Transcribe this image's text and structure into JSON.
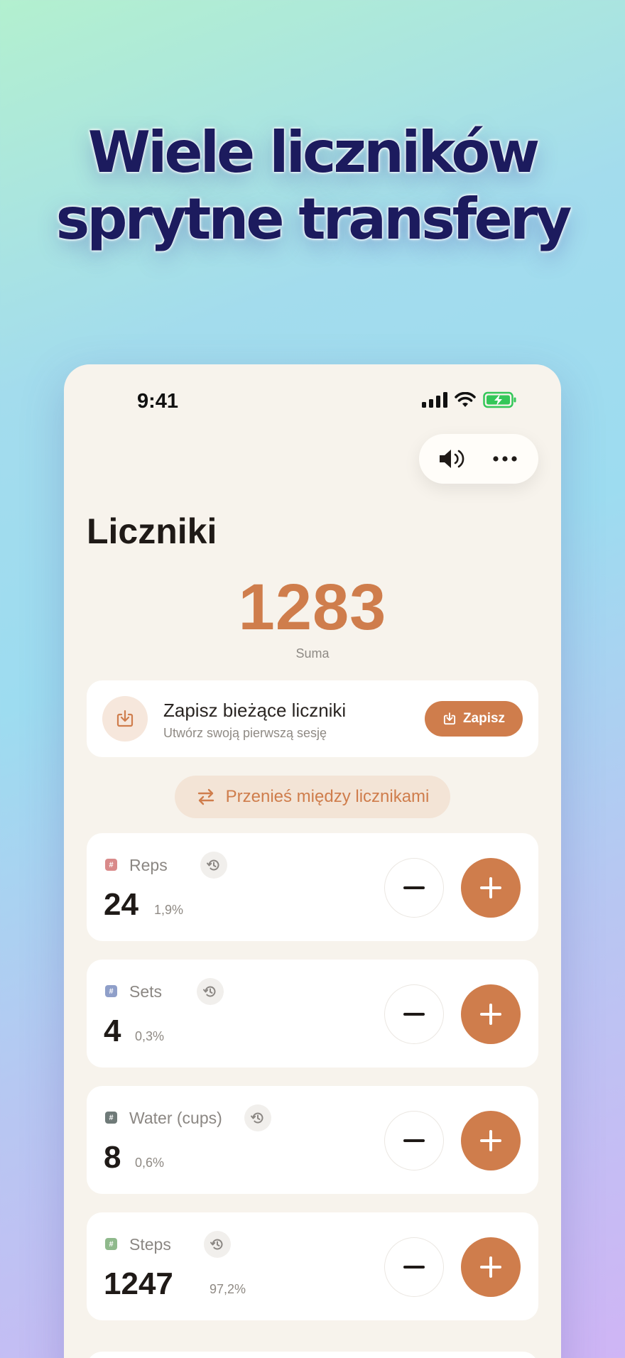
{
  "headline": {
    "line1": "Wiele liczników",
    "line2": "sprytne transfery"
  },
  "status": {
    "time": "9:41"
  },
  "page": {
    "title": "Liczniki"
  },
  "total": {
    "value": "1283",
    "label": "Suma"
  },
  "save_card": {
    "title": "Zapisz bieżące liczniki",
    "subtitle": "Utwórz swoją pierwszą sesję",
    "button_label": "Zapisz"
  },
  "transfer": {
    "label": "Przenieś między licznikami"
  },
  "counters": [
    {
      "name": "Reps",
      "value": "24",
      "percent": "1,9%",
      "tag_color": "#d98a8a"
    },
    {
      "name": "Sets",
      "value": "4",
      "percent": "0,3%",
      "tag_color": "#8f9fc9"
    },
    {
      "name": "Water (cups)",
      "value": "8",
      "percent": "0,6%",
      "tag_color": "#6f7a78"
    },
    {
      "name": "Steps",
      "value": "1247",
      "percent": "97,2%",
      "tag_color": "#8fb98c"
    }
  ],
  "colors": {
    "accent": "#cf7d4c",
    "headline": "#1c1b5e",
    "battery": "#34c759"
  },
  "icons": {
    "sound": "speaker-icon",
    "more": "more-dots-icon",
    "download": "download-tray-icon",
    "transfer": "swap-arrows-icon",
    "history": "history-icon"
  }
}
